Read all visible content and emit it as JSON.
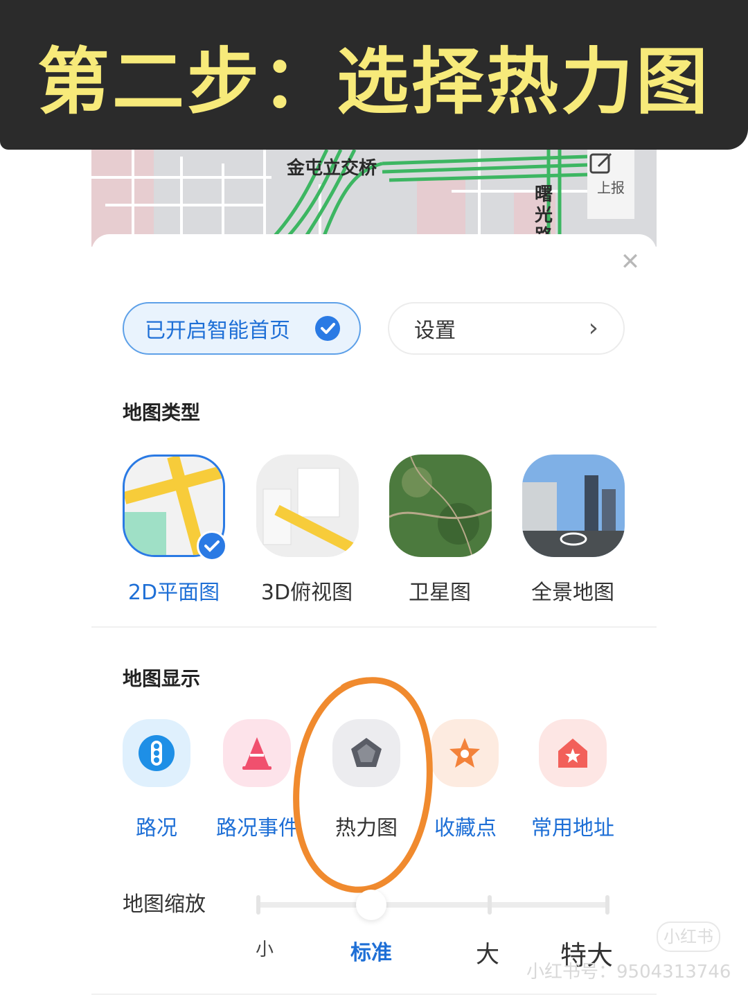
{
  "banner": {
    "title": "第二步：选择热力图"
  },
  "map": {
    "bridge_label": "金屯立交桥",
    "road_label": "曙光路",
    "report_label": "上报"
  },
  "sheet": {
    "smart_home_label": "已开启智能首页",
    "settings_label": "设置",
    "map_type_title": "地图类型",
    "map_types": [
      {
        "label": "2D平面图",
        "selected": true
      },
      {
        "label": "3D俯视图",
        "selected": false
      },
      {
        "label": "卫星图",
        "selected": false
      },
      {
        "label": "全景地图",
        "selected": false
      }
    ],
    "map_display_title": "地图显示",
    "display_items": [
      {
        "label": "路况",
        "icon": "traffic-light-icon",
        "color": "#1e8fe6",
        "bg": "#dff0fd"
      },
      {
        "label": "路况事件",
        "icon": "traffic-cone-icon",
        "color": "#f0506e",
        "bg": "#fde3ea"
      },
      {
        "label": "热力图",
        "icon": "pentagon-icon",
        "color": "#5a5d66",
        "bg": "#ececef"
      },
      {
        "label": "收藏点",
        "icon": "star-icon",
        "color": "#f3823a",
        "bg": "#fdebe0"
      },
      {
        "label": "常用地址",
        "icon": "home-icon",
        "color": "#f2605a",
        "bg": "#fde6e4"
      }
    ],
    "zoom_title": "地图缩放",
    "zoom_levels": [
      "小",
      "标准",
      "大",
      "特大"
    ],
    "zoom_selected": "标准"
  },
  "annotation": {
    "highlight_color": "#f08a2e",
    "highlighted_item": "热力图"
  },
  "watermark": {
    "badge": "小红书",
    "text": "小红书号：9504313746"
  }
}
